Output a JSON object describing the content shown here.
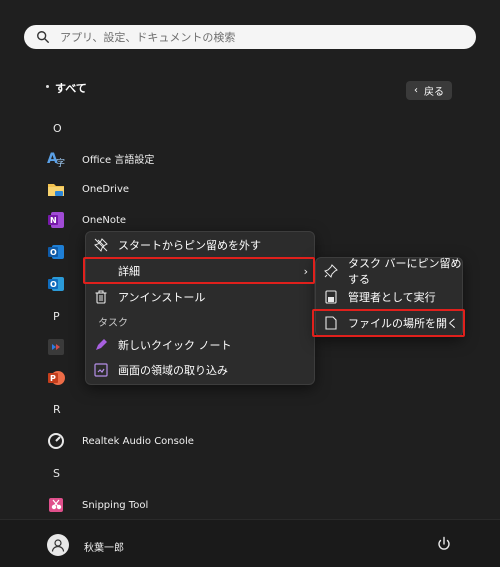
{
  "search": {
    "placeholder": "アプリ、設定、ドキュメントの検索"
  },
  "header": {
    "title": "すべて",
    "back_label": "戻る"
  },
  "letters": {
    "o": "O",
    "p": "P",
    "r": "R",
    "s": "S"
  },
  "apps": {
    "office": "Office 言語設定",
    "onedrive": "OneDrive",
    "onenote": "OneNote",
    "realtek": "Realtek Audio Console",
    "snipping": "Snipping Tool"
  },
  "context_menu": {
    "unpin": "スタートからピン留めを外す",
    "details": "詳細",
    "uninstall": "アンインストール",
    "task_header": "タスク",
    "new_quick_note": "新しいクイック ノート",
    "capture_area": "画面の領域の取り込み"
  },
  "submenu": {
    "pin_taskbar": "タスク バーにピン留めする",
    "run_admin": "管理者として実行",
    "open_location": "ファイルの場所を開く"
  },
  "user": {
    "name": "秋葉一郎"
  },
  "colors": {
    "highlight": "#e0201c",
    "background": "#1f1f1f",
    "menu": "#2c2c2c"
  }
}
